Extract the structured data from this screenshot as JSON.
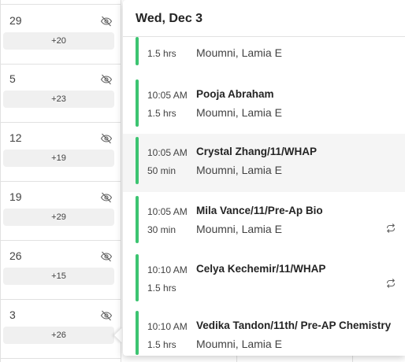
{
  "calendar": {
    "weeks": [
      {
        "day": "29",
        "more": "+20"
      },
      {
        "day": "5",
        "more": "+23"
      },
      {
        "day": "12",
        "more": "+19"
      },
      {
        "day": "19",
        "more": "+29"
      },
      {
        "day": "26",
        "more": "+15"
      },
      {
        "day": "3",
        "more": "+26"
      }
    ]
  },
  "popup": {
    "date_label": "Wed, Dec 3",
    "events": [
      {
        "time": "",
        "duration": "1.5 hrs",
        "title": "",
        "organizer": "Moumni, Lamia E",
        "recurring": false
      },
      {
        "time": "10:05 AM",
        "duration": "1.5 hrs",
        "title": "Pooja Abraham",
        "organizer": "Moumni, Lamia E",
        "recurring": false
      },
      {
        "time": "10:05 AM",
        "duration": "50 min",
        "title": "Crystal Zhang/11/WHAP",
        "organizer": "Moumni, Lamia E",
        "recurring": false
      },
      {
        "time": "10:05 AM",
        "duration": "30 min",
        "title": "Mila Vance/11/Pre-Ap Bio",
        "organizer": "Moumni, Lamia E",
        "recurring": true
      },
      {
        "time": "10:10 AM",
        "duration": "1.5 hrs",
        "title": "Celya Kechemir/11/WHAP",
        "organizer": "",
        "recurring": true
      },
      {
        "time": "10:10 AM",
        "duration": "1.5 hrs",
        "title": "Vedika Tandon/11th/ Pre-AP Chemistry",
        "organizer": "Moumni, Lamia E",
        "recurring": false
      }
    ]
  },
  "colors": {
    "event_bar": "#3cc471",
    "selected_bg": "#f5f5f5"
  },
  "icons": {
    "day_hidden": "eye-off-icon",
    "recurring": "repeat-icon"
  }
}
